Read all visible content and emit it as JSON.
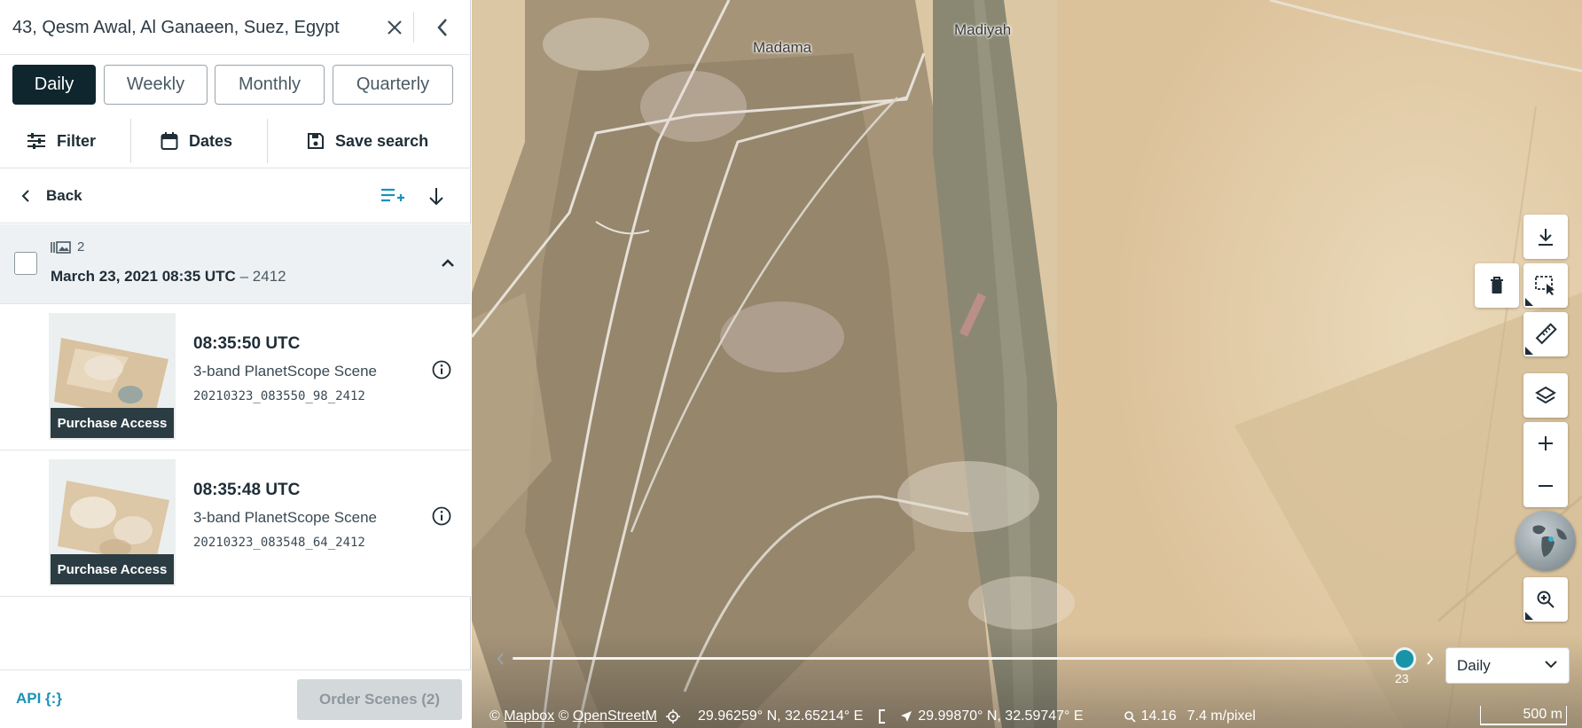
{
  "search": {
    "value": "43, Qesm Awal, Al Ganaeen, Suez, Egypt"
  },
  "periods": [
    "Daily",
    "Weekly",
    "Monthly",
    "Quarterly"
  ],
  "active_period": "Daily",
  "tools": {
    "filter": "Filter",
    "dates": "Dates",
    "save_search": "Save search"
  },
  "back": {
    "label": "Back"
  },
  "group": {
    "count": "2",
    "date": "March 23, 2021 08:35 UTC",
    "separator": "–",
    "item_id": "2412"
  },
  "scenes": [
    {
      "time": "08:35:50 UTC",
      "type": "3-band PlanetScope Scene",
      "id": "20210323_083550_98_2412",
      "badge": "Purchase Access"
    },
    {
      "time": "08:35:48 UTC",
      "type": "3-band PlanetScope Scene",
      "id": "20210323_083548_64_2412",
      "badge": "Purchase Access"
    }
  ],
  "footer": {
    "api": "API {:}",
    "order": "Order Scenes (2)"
  },
  "map": {
    "labels": {
      "madama": "Madama",
      "madiyah": "Madiyah"
    },
    "timeline_day": "23",
    "period_select": "Daily",
    "attribution": {
      "mapbox": "Mapbox",
      "osm": "OpenStreetM"
    },
    "cursor_coords": "29.96259° N, 32.65214° E",
    "center_coords": "29.99870° N, 32.59747° E",
    "zoom": "14.16",
    "resolution": "7.4 m/pixel",
    "scale": "500 m"
  },
  "colors": {
    "accent": "#1a93b8",
    "active": "#10262f",
    "timeline_thumb": "#1a93a8"
  }
}
